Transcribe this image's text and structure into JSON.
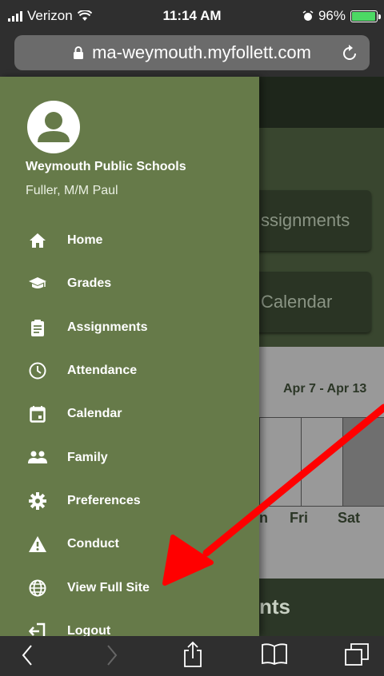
{
  "status_bar": {
    "carrier": "Verizon",
    "time": "11:14 AM",
    "battery_percent": "96%",
    "battery_level": 0.96,
    "icons": [
      "signal-icon",
      "wifi-icon",
      "alarm-icon",
      "battery-icon"
    ]
  },
  "browser": {
    "url": "ma-weymouth.myfollett.com",
    "icons": [
      "lock-icon",
      "reload-icon"
    ]
  },
  "background_page": {
    "cards": [
      "ssignments",
      "Calendar"
    ],
    "week_range": "Apr 7 - Apr 13",
    "day_labels": [
      "n",
      "Fri",
      "Sat"
    ],
    "section_fragment": "nts"
  },
  "drawer": {
    "school_name": "Weymouth Public Schools",
    "user_name": "Fuller, M/M Paul",
    "items": [
      {
        "label": "Home",
        "icon": "home-icon"
      },
      {
        "label": "Grades",
        "icon": "graduation-cap-icon"
      },
      {
        "label": "Assignments",
        "icon": "clipboard-icon"
      },
      {
        "label": "Attendance",
        "icon": "clock-icon"
      },
      {
        "label": "Calendar",
        "icon": "calendar-icon"
      },
      {
        "label": "Family",
        "icon": "family-icon"
      },
      {
        "label": "Preferences",
        "icon": "gear-icon"
      },
      {
        "label": "Conduct",
        "icon": "warning-icon"
      },
      {
        "label": "View Full Site",
        "icon": "globe-icon"
      },
      {
        "label": "Logout",
        "icon": "logout-icon"
      }
    ]
  },
  "toolbar": {
    "icons": [
      "back-icon",
      "forward-icon",
      "share-icon",
      "bookmarks-icon",
      "tabs-icon"
    ]
  },
  "colors": {
    "drawer_bg": "#667a49",
    "annotation_arrow": "#ff0000",
    "battery_fill": "#4cd964"
  }
}
